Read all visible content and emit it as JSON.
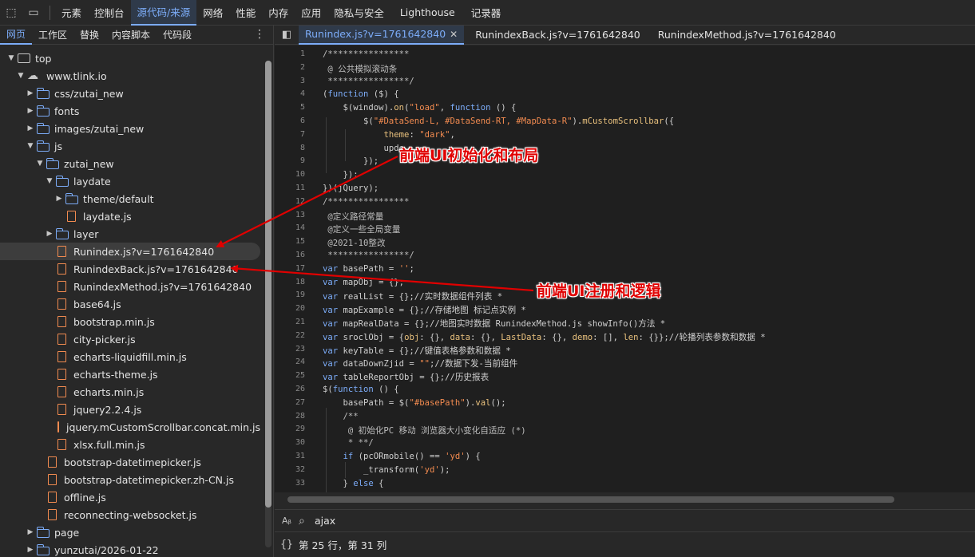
{
  "toolbar": {
    "tabs": [
      "元素",
      "控制台",
      "源代码/来源",
      "网络",
      "性能",
      "内存",
      "应用",
      "隐私与安全",
      "Lighthouse",
      "记录器"
    ]
  },
  "sidebar": {
    "tabs": [
      "网页",
      "工作区",
      "替换",
      "内容脚本",
      "代码段"
    ],
    "tree": [
      {
        "label": "top"
      },
      {
        "label": "www.tlink.io"
      },
      {
        "label": "css/zutai_new"
      },
      {
        "label": "fonts"
      },
      {
        "label": "images/zutai_new"
      },
      {
        "label": "js"
      },
      {
        "label": "zutai_new"
      },
      {
        "label": "laydate"
      },
      {
        "label": "theme/default"
      },
      {
        "label": "laydate.js"
      },
      {
        "label": "layer"
      },
      {
        "label": "Runindex.js?v=1761642840"
      },
      {
        "label": "RunindexBack.js?v=1761642840"
      },
      {
        "label": "RunindexMethod.js?v=1761642840"
      },
      {
        "label": "base64.js"
      },
      {
        "label": "bootstrap.min.js"
      },
      {
        "label": "city-picker.js"
      },
      {
        "label": "echarts-liquidfill.min.js"
      },
      {
        "label": "echarts-theme.js"
      },
      {
        "label": "echarts.min.js"
      },
      {
        "label": "jquery2.2.4.js"
      },
      {
        "label": "jquery.mCustomScrollbar.concat.min.js"
      },
      {
        "label": "xlsx.full.min.js"
      },
      {
        "label": "bootstrap-datetimepicker.js"
      },
      {
        "label": "bootstrap-datetimepicker.zh-CN.js"
      },
      {
        "label": "offline.js"
      },
      {
        "label": "reconnecting-websocket.js"
      },
      {
        "label": "page"
      },
      {
        "label": "yunzutai/2026-01-22"
      }
    ]
  },
  "editor": {
    "tabs": [
      "Runindex.js?v=1761642840",
      "RunindexBack.js?v=1761642840",
      "RunindexMethod.js?v=1761642840"
    ],
    "lines": [
      {
        "n": "1",
        "t": "/****************"
      },
      {
        "n": "2",
        "t": " @ 公共模拟滚动条"
      },
      {
        "n": "3",
        "t": " ****************/"
      },
      {
        "n": "4",
        "t": "(function ($) {"
      },
      {
        "n": "5",
        "t": "    $(window).on(\"load\", function () {"
      },
      {
        "n": "6",
        "t": "        $(\"#DataSend-L, #DataSend-RT, #MapData-R\").mCustomScrollbar({"
      },
      {
        "n": "7",
        "t": "            theme: \"dark\","
      },
      {
        "n": "8",
        "t": "            upde"
      },
      {
        "n": "9",
        "t": "        });"
      },
      {
        "n": "10",
        "t": "    });"
      },
      {
        "n": "11",
        "t": "})(jQuery);"
      },
      {
        "n": "12",
        "t": "/****************"
      },
      {
        "n": "13",
        "t": " @定义路径常量"
      },
      {
        "n": "14",
        "t": " @定义一些全局变量"
      },
      {
        "n": "15",
        "t": " @2021-10整改"
      },
      {
        "n": "16",
        "t": " ****************/"
      },
      {
        "n": "17",
        "t": "var basePath = '';"
      },
      {
        "n": "18",
        "t": "var mapObj = {};"
      },
      {
        "n": "19",
        "t": "var realList = {};//实时数据组件列表 *"
      },
      {
        "n": "20",
        "t": "var mapExample = {};//存储地图 标记点实例 *"
      },
      {
        "n": "21",
        "t": "var mapRealData = {};//地图实时数据 RunindexMethod.js showInfo()方法 *"
      },
      {
        "n": "22",
        "t": "var sroclObj = {obj: {}, data: {}, LastData: {}, demo: [], len: {}};//轮播列表参数和数据 *"
      },
      {
        "n": "23",
        "t": "var keyTable = {};//键值表格参数和数据 *"
      },
      {
        "n": "24",
        "t": "var dataDownZjid = \"\";//数据下发-当前组件"
      },
      {
        "n": "25",
        "t": "var tableReportObj = {};//历史报表"
      },
      {
        "n": "26",
        "t": "$(function () {"
      },
      {
        "n": "27",
        "t": "    basePath = $(\"#basePath\").val();"
      },
      {
        "n": "28",
        "t": "    /**"
      },
      {
        "n": "29",
        "t": "     @ 初始化PC 移动 浏览器大小变化自适应 (*)"
      },
      {
        "n": "30",
        "t": "     * **/"
      },
      {
        "n": "31",
        "t": "    if (pcORmobile() == 'yd') {"
      },
      {
        "n": "32",
        "t": "        _transform('yd');"
      },
      {
        "n": "33",
        "t": "    } else {"
      }
    ]
  },
  "search": {
    "value": "ajax"
  },
  "status": {
    "position": "第 25 行，第 31 列"
  },
  "annotations": {
    "a1": "前端UI初始化和布局",
    "a2": "前端UI注册和逻辑"
  },
  "colors": {
    "accent": "#7cacf8",
    "annotation": "#e00000",
    "file_icon": "#f28b50"
  }
}
